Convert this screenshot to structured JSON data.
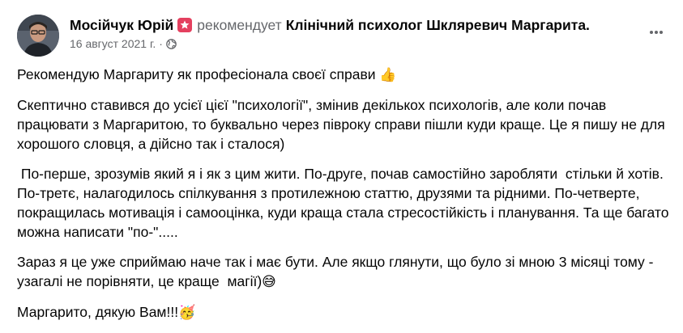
{
  "post": {
    "author": "Мосійчук Юрій",
    "verb": "рекомендует",
    "page_name": "Клінічний психолог Шкляревич Маргарита.",
    "date": "16 август 2021 г.",
    "dot": "·",
    "paragraphs": [
      "Рекомендую Маргариту як професіонала своєї справи",
      "Скептично ставився до усієї цієї \"психології\", змінив декількох психологів, але коли почав працювати з Маргаритою, то буквально через півроку справи пішли куди краще. Це я пишу не для хорошого словця, а дійсно так і сталося)",
      " По-перше, зрозумів який я і як з цим жити. По-друге, почав самостійно заробляти  стільки й хотів. По-третє, налагодилось спілкування з протилежною статтю, друзями та рідними. По-четверте, покращилась мотивація і самооцінка, куди краща стала стресостійкість і планування. Та ще багато можна написати \"по-\".....",
      "Зараз я це уже сприймаю наче так і має бути. Але якщо глянути, що було зі мною 3 місяці тому - узагалі не порівняти, це краще  магії)",
      "Маргарито, дякую Вам!!!"
    ],
    "emojis": {
      "thumbs_up": "👍",
      "grin_sweat": "😅",
      "party": "🥳"
    }
  },
  "icons": {
    "badge": "star-badge-icon",
    "privacy": "globe-icon",
    "more": "more-options-icon"
  },
  "colors": {
    "text": "#050505",
    "secondary": "#65676b",
    "badge": "#e4405f"
  }
}
